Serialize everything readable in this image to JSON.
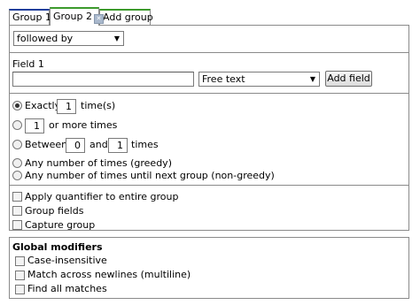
{
  "tabs": [
    {
      "label": "Group 1"
    },
    {
      "label": "Group 2"
    },
    {
      "label": "Add group"
    }
  ],
  "relation_select": {
    "value": "followed by"
  },
  "field": {
    "label": "Field 1",
    "value": "",
    "type_select": "Free text",
    "add_button": "Add field"
  },
  "quantifiers": {
    "exactly_label": "Exactly",
    "exactly_value": "1",
    "exactly_suffix": "time(s)",
    "or_more_value": "1",
    "or_more_suffix": "or more times",
    "between_label": "Between",
    "between_min": "0",
    "between_and": "and",
    "between_max": "1",
    "between_suffix": "times",
    "greedy_label": "Any number of times (greedy)",
    "nongreedy_label": "Any number of times until next group (non-greedy)",
    "selected": "exactly"
  },
  "group_options": [
    {
      "label": "Apply quantifier to entire group",
      "checked": false
    },
    {
      "label": "Group fields",
      "checked": false
    },
    {
      "label": "Capture group",
      "checked": false
    }
  ],
  "global": {
    "title": "Global modifiers",
    "options": [
      {
        "label": "Case-insensitive",
        "checked": false
      },
      {
        "label": "Match across newlines (multiline)",
        "checked": false
      },
      {
        "label": "Find all matches",
        "checked": false
      }
    ]
  },
  "icons": {
    "tab_close": "close-icon",
    "dropdown": "chevron-down-icon"
  }
}
